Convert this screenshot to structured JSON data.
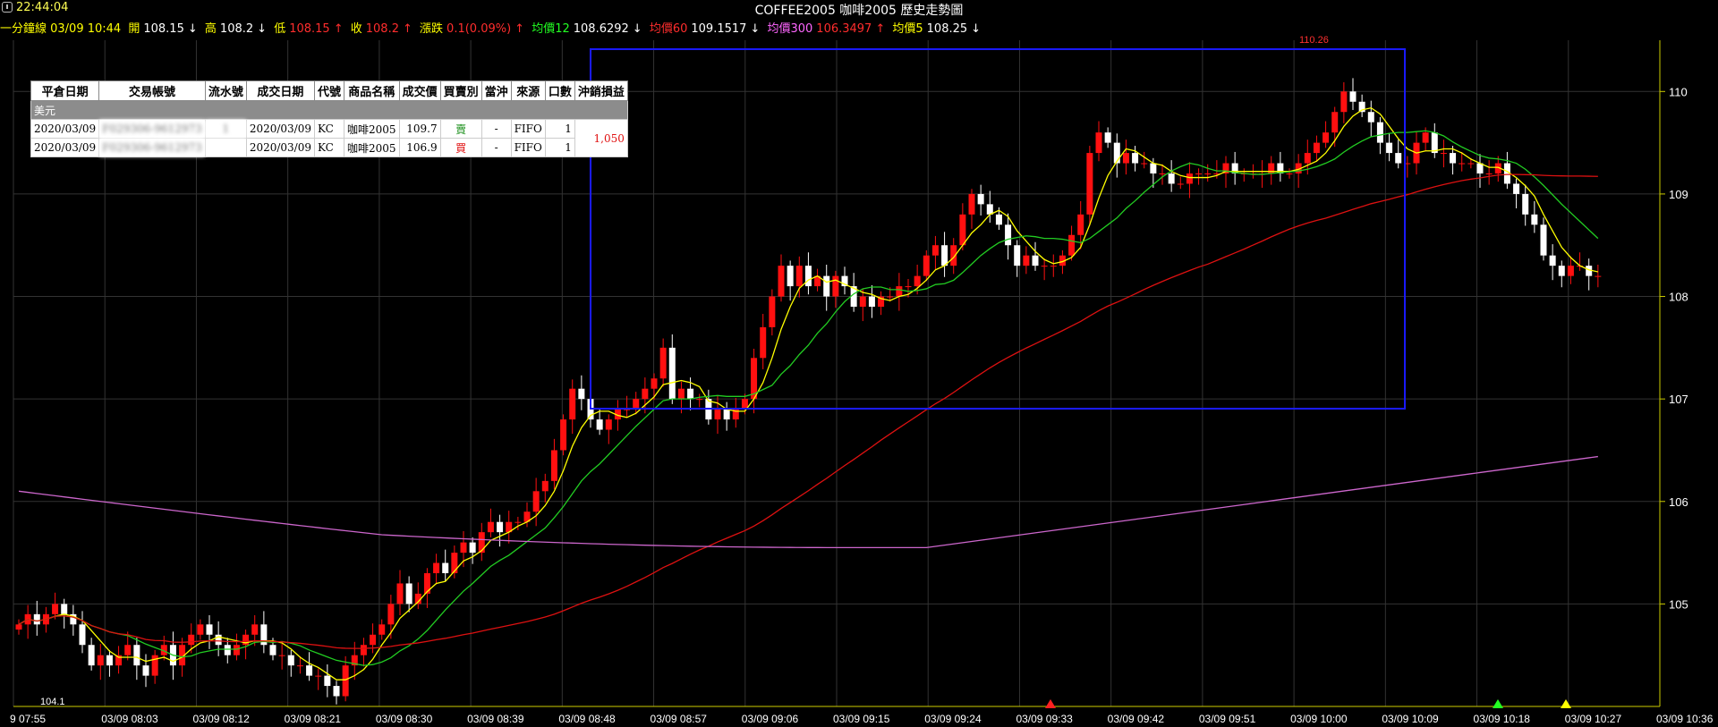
{
  "clock": "22:44:04",
  "title": "COFFEE2005 咖啡2005  歷史走勢圖",
  "info": {
    "period": "一分鐘線 03/09 10:44",
    "open_label": "開",
    "open": "108.15",
    "high_label": "高",
    "high": "108.2",
    "low_label": "低",
    "low": "108.15",
    "close_label": "收",
    "close": "108.2",
    "chg_label": "漲跌",
    "chg": "0.1(0.09%)",
    "ma12_label": "均價12",
    "ma12": "108.6292",
    "ma60_label": "均價60",
    "ma60": "109.1517",
    "ma300_label": "均價300",
    "ma300": "106.3497",
    "ma5_label": "均價5",
    "ma5": "108.25"
  },
  "colors": {
    "up": "#ff1010",
    "down": "#ffffff",
    "ma5": "#ffff00",
    "ma12": "#22cc22",
    "ma60": "#dd1111",
    "ma300": "#cc66cc",
    "axis": "#cccc00",
    "box": "#1a1aff",
    "grid": "#333333"
  },
  "trades": {
    "headers": [
      "平倉日期",
      "交易帳號",
      "流水號",
      "成交日期",
      "代號",
      "商品名稱",
      "成交價",
      "買賣別",
      "當沖",
      "來源",
      "口數",
      "沖銷損益"
    ],
    "group_label": "美元",
    "rows": [
      {
        "close_date": "2020/03/09",
        "account": "F029306-9612973",
        "serial": "1",
        "trade_date": "2020/03/09",
        "code": "KC",
        "name": "咖啡2005",
        "price": "109.7",
        "side": "賣",
        "daytrade": "-",
        "source": "FIFO",
        "qty": "1"
      },
      {
        "close_date": "2020/03/09",
        "account": "F029306-9612973",
        "serial": "",
        "trade_date": "2020/03/09",
        "code": "KC",
        "name": "咖啡2005",
        "price": "106.9",
        "side": "買",
        "daytrade": "-",
        "source": "FIFO",
        "qty": "1"
      }
    ],
    "pnl": "1,050"
  },
  "chart_data": {
    "type": "candlestick",
    "title": "COFFEE2005 咖啡2005  歷史走勢圖",
    "xlabel": "",
    "ylabel": "",
    "ylim": [
      104.0,
      110.5
    ],
    "yticks": [
      105,
      106,
      107,
      108,
      109,
      110
    ],
    "xtick_labels": [
      "9 07:55",
      "03/09 08:03",
      "03/09 08:12",
      "03/09 08:21",
      "03/09 08:30",
      "03/09 08:39",
      "03/09 08:48",
      "03/09 08:57",
      "03/09 09:06",
      "03/09 09:15",
      "03/09 09:24",
      "03/09 09:33",
      "03/09 09:42",
      "03/09 09:51",
      "03/09 10:00",
      "03/09 10:09",
      "03/09 10:18",
      "03/09 10:27",
      "03/09 10:36"
    ],
    "annotations": {
      "high_label": "110.26",
      "low_label": "104.1"
    },
    "closes": [
      104.8,
      104.9,
      104.8,
      104.9,
      105.0,
      104.9,
      104.8,
      104.6,
      104.4,
      104.5,
      104.4,
      104.5,
      104.6,
      104.4,
      104.3,
      104.5,
      104.6,
      104.4,
      104.6,
      104.7,
      104.8,
      104.7,
      104.6,
      104.5,
      104.6,
      104.7,
      104.8,
      104.6,
      104.5,
      104.5,
      104.4,
      104.4,
      104.3,
      104.3,
      104.2,
      104.1,
      104.4,
      104.5,
      104.6,
      104.7,
      104.8,
      105.0,
      105.2,
      105.0,
      105.1,
      105.3,
      105.4,
      105.3,
      105.5,
      105.6,
      105.5,
      105.7,
      105.8,
      105.7,
      105.8,
      105.8,
      105.9,
      106.1,
      106.2,
      106.5,
      106.8,
      107.1,
      107.0,
      106.8,
      106.7,
      106.8,
      106.9,
      106.9,
      107.0,
      107.1,
      107.2,
      107.5,
      107.0,
      107.1,
      107.0,
      107.0,
      106.8,
      106.9,
      106.8,
      106.9,
      107.0,
      107.4,
      107.7,
      108.0,
      108.3,
      108.1,
      108.3,
      108.1,
      108.2,
      108.0,
      108.2,
      108.1,
      107.9,
      108.0,
      107.9,
      108.0,
      108.0,
      108.1,
      108.1,
      108.2,
      108.4,
      108.5,
      108.3,
      108.5,
      108.8,
      109.0,
      108.9,
      108.8,
      108.7,
      108.5,
      108.3,
      108.4,
      108.3,
      108.3,
      108.3,
      108.4,
      108.6,
      108.8,
      109.4,
      109.6,
      109.5,
      109.3,
      109.4,
      109.3,
      109.3,
      109.2,
      109.2,
      109.1,
      109.1,
      109.2,
      109.2,
      109.2,
      109.2,
      109.3,
      109.2,
      109.2,
      109.2,
      109.2,
      109.3,
      109.2,
      109.2,
      109.3,
      109.4,
      109.5,
      109.6,
      109.8,
      110.0,
      109.9,
      109.8,
      109.7,
      109.5,
      109.4,
      109.3,
      109.3,
      109.5,
      109.6,
      109.4,
      109.4,
      109.3,
      109.3,
      109.3,
      109.2,
      109.2,
      109.3,
      109.1,
      109.0,
      108.8,
      108.7,
      108.4,
      108.3,
      108.2,
      108.3,
      108.3,
      108.2,
      108.2
    ]
  }
}
